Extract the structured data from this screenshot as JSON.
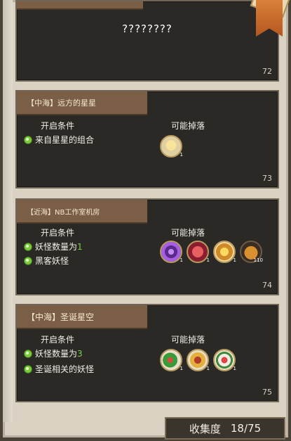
{
  "cards": [
    {
      "title": "????????",
      "number": "72"
    },
    {
      "tab": "【中海】远方的星星",
      "cond_heading": "开启条件",
      "drop_heading": "可能掉落",
      "conditions": [
        {
          "text": "来自星星的组合"
        }
      ],
      "drops": [
        {
          "icon": "star-shard-icon",
          "qty": "1"
        }
      ],
      "number": "73"
    },
    {
      "tab": "【近海】NB工作室机房",
      "cond_heading": "开启条件",
      "drop_heading": "可能掉落",
      "conditions": [
        {
          "text": "妖怪数量为",
          "value": "1"
        },
        {
          "text": "黑客妖怪"
        }
      ],
      "drops": [
        {
          "icon": "purple-swirl-icon",
          "qty": "1"
        },
        {
          "icon": "red-mask-icon",
          "qty": "1"
        },
        {
          "icon": "golden-sun-icon",
          "qty": "1"
        },
        {
          "icon": "money-bag-icon",
          "qty": "110"
        }
      ],
      "number": "74"
    },
    {
      "tab": "【中海】圣诞星空",
      "cond_heading": "开启条件",
      "drop_heading": "可能掉落",
      "conditions": [
        {
          "text": "妖怪数量为",
          "value": "3"
        },
        {
          "text": "圣诞相关的妖怪"
        }
      ],
      "drops": [
        {
          "icon": "holly-creature-icon",
          "qty": "1"
        },
        {
          "icon": "christmas-bell-icon",
          "qty": "1"
        },
        {
          "icon": "candy-cane-icon",
          "qty": "1"
        }
      ],
      "number": "75"
    }
  ],
  "footer": {
    "label": "收集度",
    "progress": "18/75"
  },
  "colors": {
    "card_bg": "#2b2925",
    "tab_bg": "#7a5f46",
    "condition_value_green": "#78d33e"
  }
}
